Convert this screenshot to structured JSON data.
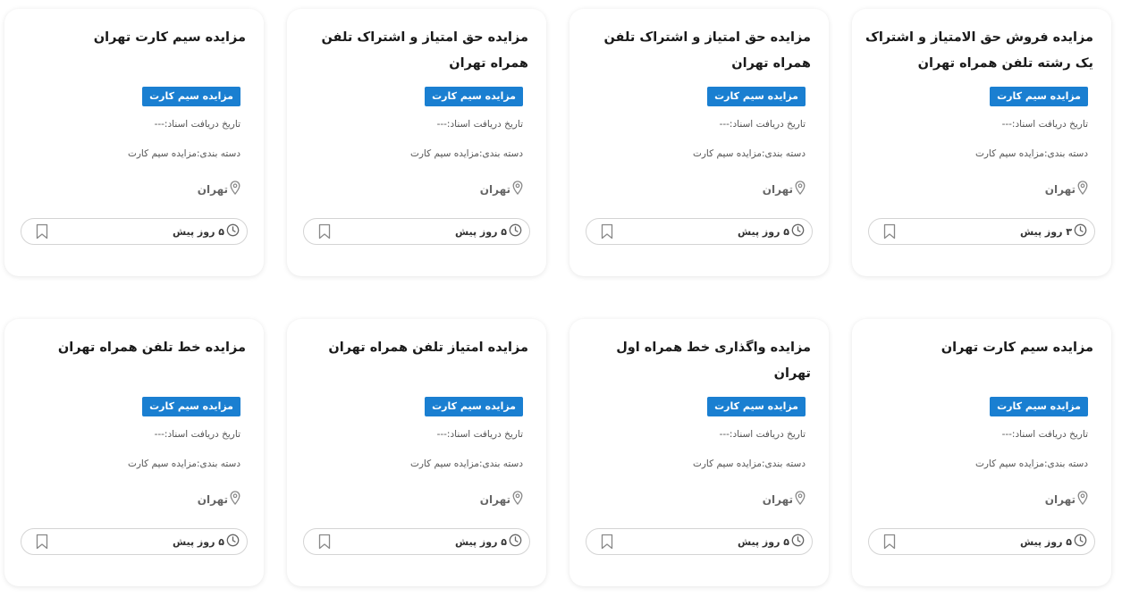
{
  "cards": [
    {
      "title": "مزایده فروش حق الامتیاز و اشتراک یک رشته تلفن همراه تهران",
      "badge": "مزایده سیم کارت",
      "date": "تاریخ دریافت اسناد:---",
      "category": "دسته بندی:مزایده سیم کارت",
      "location": "تهران",
      "time": "۳ روز پیش"
    },
    {
      "title": "مزایده حق امتیاز و اشتراک تلفن همراه تهران",
      "badge": "مزایده سیم کارت",
      "date": "تاریخ دریافت اسناد:---",
      "category": "دسته بندی:مزایده سیم کارت",
      "location": "تهران",
      "time": "۵ روز پیش"
    },
    {
      "title": "مزایده حق امتیاز و اشتراک تلفن همراه تهران",
      "badge": "مزایده سیم کارت",
      "date": "تاریخ دریافت اسناد:---",
      "category": "دسته بندی:مزایده سیم کارت",
      "location": "تهران",
      "time": "۵ روز پیش"
    },
    {
      "title": "مزایده سیم کارت تهران",
      "badge": "مزایده سیم کارت",
      "date": "تاریخ دریافت اسناد:---",
      "category": "دسته بندی:مزایده سیم کارت",
      "location": "تهران",
      "time": "۵ روز پیش"
    },
    {
      "title": "مزایده سیم کارت تهران",
      "badge": "مزایده سیم کارت",
      "date": "تاریخ دریافت اسناد:---",
      "category": "دسته بندی:مزایده سیم کارت",
      "location": "تهران",
      "time": "۵ روز پیش"
    },
    {
      "title": "مزایده واگذاری خط همراه اول تهران",
      "badge": "مزایده سیم کارت",
      "date": "تاریخ دریافت اسناد:---",
      "category": "دسته بندی:مزایده سیم کارت",
      "location": "تهران",
      "time": "۵ روز پیش"
    },
    {
      "title": "مزایده امتیاز تلفن همراه تهران",
      "badge": "مزایده سیم کارت",
      "date": "تاریخ دریافت اسناد:---",
      "category": "دسته بندی:مزایده سیم کارت",
      "location": "تهران",
      "time": "۵ روز پیش"
    },
    {
      "title": "مزایده خط تلفن همراه تهران",
      "badge": "مزایده سیم کارت",
      "date": "تاریخ دریافت اسناد:---",
      "category": "دسته بندی:مزایده سیم کارت",
      "location": "تهران",
      "time": "۵ روز پیش"
    }
  ],
  "icons": {
    "location": "map-pin-icon",
    "time": "clock-icon",
    "bookmark": "bookmark-icon"
  },
  "colors": {
    "badge": "#1a7fd1",
    "icon": "#888888"
  }
}
